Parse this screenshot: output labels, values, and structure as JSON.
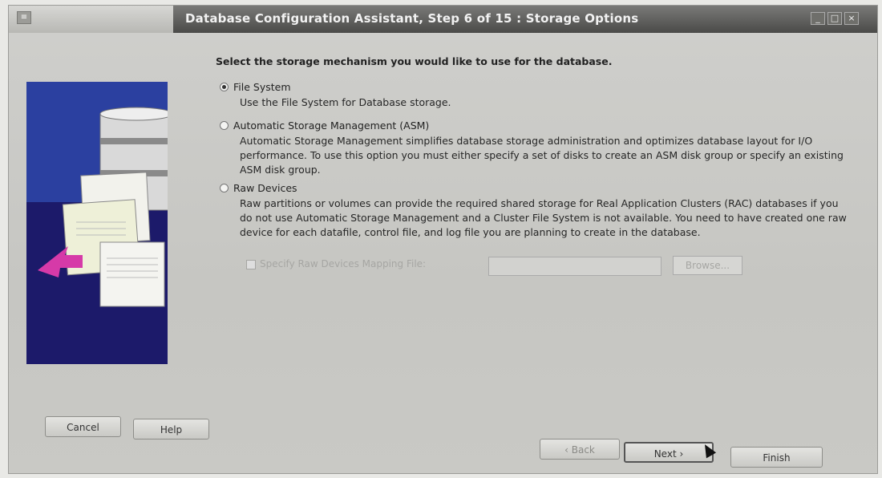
{
  "window": {
    "title": "Database Configuration Assistant, Step 6 of 15 : Storage Options"
  },
  "content": {
    "heading": "Select the storage mechanism you would like to use for the database.",
    "options": [
      {
        "label": "File System",
        "selected": true,
        "description": "Use the File System for Database storage."
      },
      {
        "label": "Automatic Storage Management (ASM)",
        "selected": false,
        "description": "Automatic Storage Management simplifies database storage administration and optimizes database layout for I/O performance. To use this option you must either specify a set of disks to create an ASM disk group or specify an existing ASM disk group."
      },
      {
        "label": "Raw Devices",
        "selected": false,
        "description": "Raw partitions or volumes can provide the required shared storage for Real Application Clusters (RAC) databases if you do not use Automatic Storage Management and a Cluster File System is not available. You need to have created one raw device for each datafile, control file, and log file you are planning to create in the database."
      }
    ],
    "raw_mapping": {
      "checkbox_label": "Specify Raw Devices Mapping File:",
      "input_value": "",
      "browse_label": "Browse..."
    }
  },
  "buttons": {
    "cancel": "Cancel",
    "help": "Help",
    "back": "Back",
    "next": "Next",
    "finish": "Finish"
  },
  "colors": {
    "titlebar": "#4a4a48",
    "wizard_panel": "#1c1a6a",
    "arrow_accent": "#d63aa8"
  }
}
